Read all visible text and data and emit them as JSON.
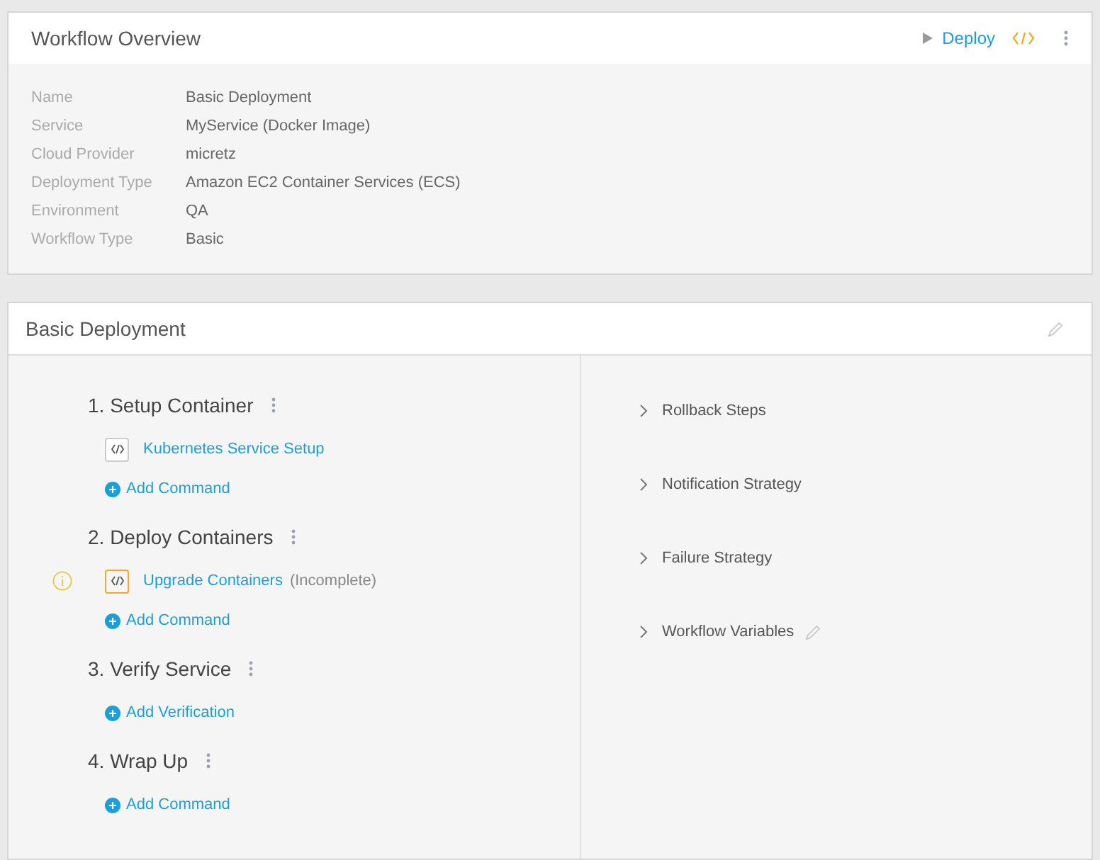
{
  "overview": {
    "title": "Workflow Overview",
    "deploy_label": "Deploy",
    "fields": [
      {
        "label": "Name",
        "value": "Basic Deployment"
      },
      {
        "label": "Service",
        "value": "MyService (Docker Image)"
      },
      {
        "label": "Cloud Provider",
        "value": "micretz"
      },
      {
        "label": "Deployment Type",
        "value": "Amazon EC2 Container Services (ECS)"
      },
      {
        "label": "Environment",
        "value": "QA"
      },
      {
        "label": "Workflow Type",
        "value": "Basic"
      }
    ]
  },
  "deployment": {
    "title": "Basic Deployment",
    "phases": [
      {
        "title": "1. Setup Container",
        "steps": [
          {
            "name": "Kubernetes Service Setup",
            "warning": false
          }
        ],
        "add_label": "Add Command"
      },
      {
        "title": "2. Deploy Containers",
        "steps": [
          {
            "name": "Upgrade Containers",
            "note": "(Incomplete)",
            "warning": true
          }
        ],
        "add_label": "Add Command"
      },
      {
        "title": "3. Verify Service",
        "add_label": "Add Verification"
      },
      {
        "title": "4. Wrap Up",
        "add_label": "Add Command"
      }
    ],
    "sections": [
      {
        "label": "Rollback Steps",
        "expanded": false,
        "editable": false
      },
      {
        "label": "Notification Strategy",
        "expanded": false,
        "editable": false
      },
      {
        "label": "Failure Strategy",
        "expanded": false,
        "editable": false
      },
      {
        "label": "Workflow Variables",
        "expanded": false,
        "editable": true
      }
    ]
  }
}
